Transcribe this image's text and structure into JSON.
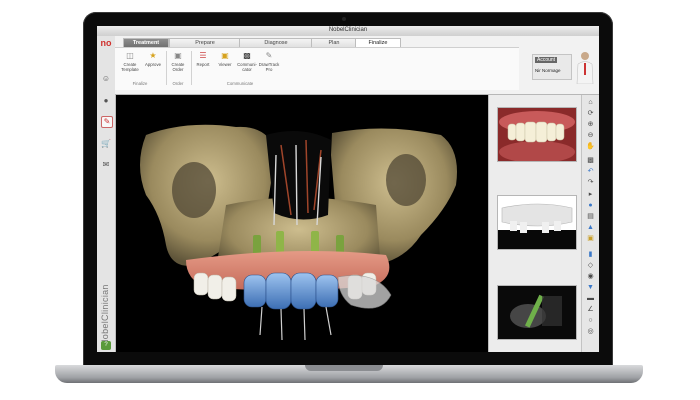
{
  "window": {
    "title": "NobelClinician"
  },
  "brand": {
    "vertical_label": "NobelClinician",
    "logo_text": "no"
  },
  "colors": {
    "brand_red": "#d0312d",
    "viewport_bg": "#000000",
    "help_green": "#5a9a3b"
  },
  "sidebar": {
    "items": [
      {
        "icon": "patient-icon"
      },
      {
        "icon": "plan-icon",
        "active": true
      },
      {
        "icon": "cart-icon"
      },
      {
        "icon": "handshake-icon"
      }
    ],
    "help_icon": "help-icon"
  },
  "ribbon": {
    "tabs": [
      "Treatment",
      "Prepare",
      "Diagnose",
      "Plan",
      "Finalize"
    ],
    "selected_tab": "Finalize",
    "groups": [
      {
        "name": "Finalize",
        "buttons": [
          {
            "label": "Create Template",
            "icon": "template-icon"
          },
          {
            "label": "Approve",
            "icon": "approve-icon"
          }
        ]
      },
      {
        "name": "Order",
        "buttons": [
          {
            "label": "Create Order",
            "icon": "order-cart-icon"
          }
        ]
      },
      {
        "name": "Communicate",
        "buttons": [
          {
            "label": "Report",
            "icon": "report-icon"
          },
          {
            "label": "Viewer",
            "icon": "viewer-icon"
          },
          {
            "label": "Communi-cator",
            "icon": "communicator-icon"
          },
          {
            "label": "DrawTrack Pro",
            "icon": "draw-icon"
          }
        ]
      }
    ]
  },
  "account": {
    "title": "Account",
    "user": "Nir Normage"
  },
  "thumbnails": [
    {
      "name": "intraoral-photo",
      "kind": "photo"
    },
    {
      "name": "3d-model",
      "kind": "model"
    },
    {
      "name": "ct-slice",
      "kind": "ct"
    }
  ],
  "tools": [
    "home-icon",
    "rotate-icon",
    "zoom-in-icon",
    "zoom-out-icon",
    "pan-icon",
    "save-icon",
    "undo-icon",
    "redo-icon",
    "measure-icon",
    "sphere-icon",
    "layers-icon",
    "fill-icon",
    "note-icon",
    "implant-icon",
    "abutment-icon",
    "teeth-icon",
    "screw-icon",
    "ruler-icon",
    "angle-icon",
    "tube-icon",
    "eye-icon"
  ]
}
